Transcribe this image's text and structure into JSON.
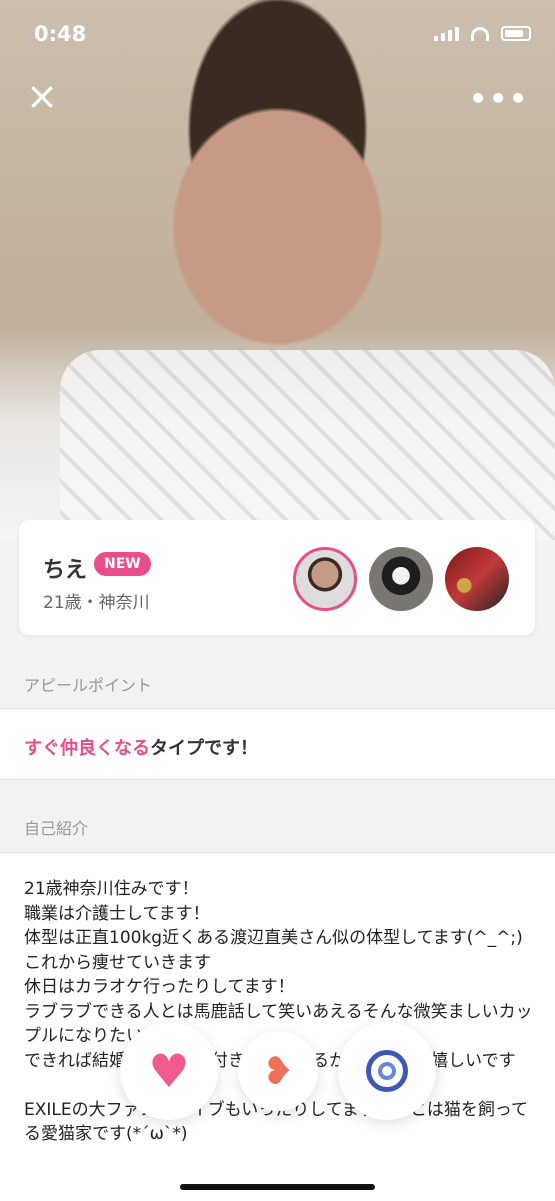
{
  "status": {
    "time": "0:48"
  },
  "profile": {
    "name": "ちえ",
    "badge": "NEW",
    "age_location": "21歳・神奈川"
  },
  "appeal": {
    "section_label": "アピールポイント",
    "highlight": "すぐ仲良くなる",
    "rest": "タイプです！"
  },
  "bio": {
    "section_label": "自己紹介",
    "text": "21歳神奈川住みです！\n職業は介護士してます！\n体型は正直100kg近くある渡辺直美さん似の体型してます(^_^;)\nこれから痩せていきます\n休日はカラオケ行ったりしてます！\nラブラブできる人とは馬鹿話して笑いあえるそんな微笑ましいカップルになりたいです\nできれば結婚を前提にお付き合いできるかたがいたら嬉しいです\n\nEXILEの大ファンでライブもいったりしてます！あとは猫を飼ってる愛猫家です(*´ω`*)"
  },
  "icons": {
    "close": "close-icon",
    "more": "more-icon",
    "like": "heart-icon",
    "super_like": "cupid-arrow-heart-icon",
    "skip": "swirl-icon"
  },
  "colors": {
    "accent": "#e94e8a"
  }
}
